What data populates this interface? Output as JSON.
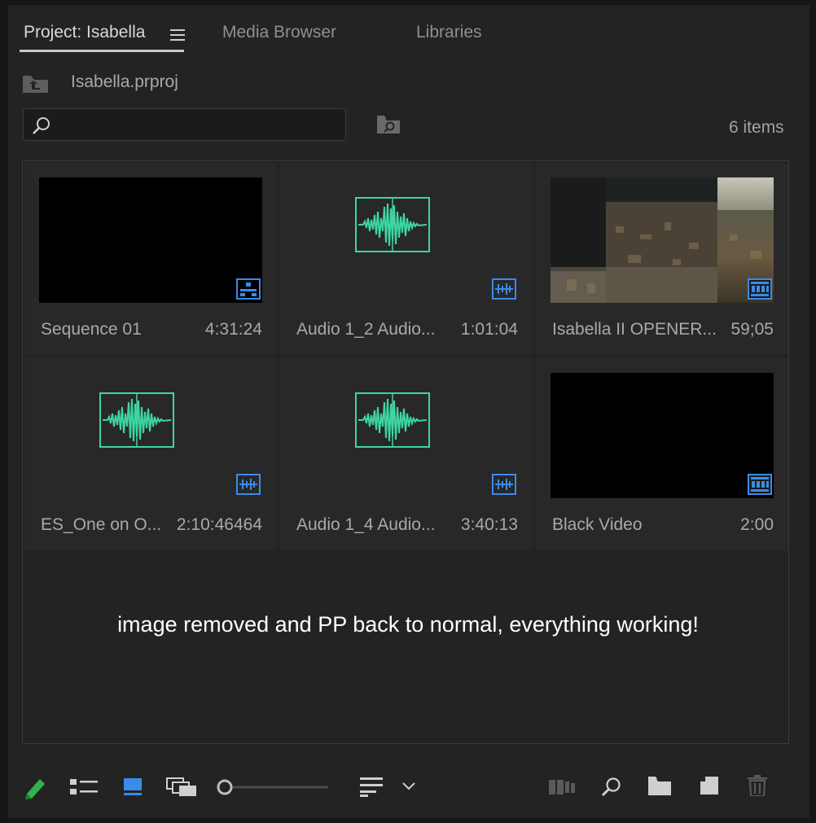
{
  "tabs": [
    {
      "label": "Project: Isabella",
      "active": true
    },
    {
      "label": "Media Browser",
      "active": false
    },
    {
      "label": "Libraries",
      "active": false
    }
  ],
  "project": {
    "file_name": "Isabella.prproj"
  },
  "search": {
    "value": "",
    "placeholder": ""
  },
  "item_count": "6 items",
  "items": [
    {
      "name": "Sequence 01",
      "duration": "4:31:24",
      "type": "sequence",
      "badge_icon": "sequence-badge-icon"
    },
    {
      "name": "Audio 1_2 Audio...",
      "duration": "1:01:04",
      "type": "audio",
      "badge_icon": "audio-badge-icon"
    },
    {
      "name": "Isabella II OPENER...",
      "duration": "59;05",
      "type": "video",
      "badge_icon": "video-badge-icon"
    },
    {
      "name": "ES_One on O...",
      "duration": "2:10:46464",
      "type": "audio",
      "badge_icon": "audio-badge-icon"
    },
    {
      "name": "Audio 1_4 Audio...",
      "duration": "3:40:13",
      "type": "audio",
      "badge_icon": "audio-badge-icon"
    },
    {
      "name": "Black Video",
      "duration": "2:00",
      "type": "video",
      "badge_icon": "video-badge-icon"
    }
  ],
  "message": "image removed and PP back to normal, everything working!",
  "colors": {
    "accent_blue": "#3b8be8",
    "audio_green": "#3ed6a0",
    "pencil_green": "#33b24c",
    "panel_bg": "#232323",
    "tile_bg": "#282828"
  },
  "toolbar": {
    "zoom_fraction": 0.0,
    "icons": [
      "pencil-icon",
      "list-view-icon",
      "icon-view-icon",
      "freeform-view-icon",
      "zoom-slider",
      "sort-icon",
      "sort-dropdown-icon",
      "automate-to-sequence-icon",
      "find-icon",
      "new-bin-icon",
      "new-item-icon",
      "clear-icon"
    ]
  }
}
